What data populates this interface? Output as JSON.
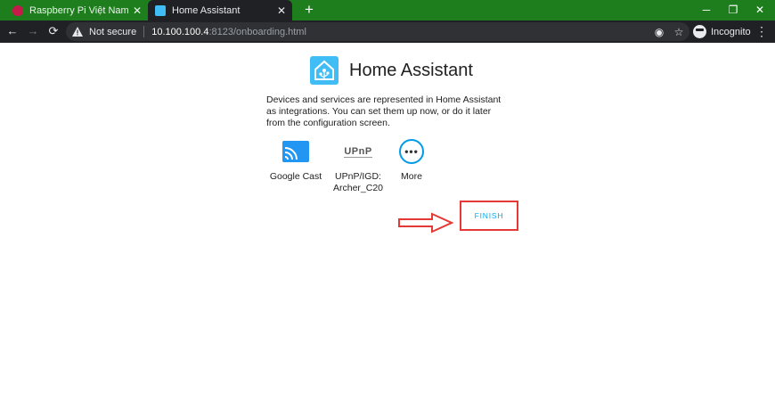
{
  "browser": {
    "tabs": [
      {
        "title": "Raspberry Pi Việt Nam - Nhà Phâ",
        "favicon": "raspberry-pi-icon",
        "active": false
      },
      {
        "title": "Home Assistant",
        "favicon": "home-assistant-icon",
        "active": true
      }
    ],
    "new_tab": "+",
    "security_label": "Not secure",
    "url_host": "10.100.100.4",
    "url_rest": ":8123/onboarding.html",
    "profile_label": "Incognito",
    "colors": {
      "tabstrip": "#1e7e1e",
      "toolbar": "#202124"
    }
  },
  "page": {
    "brand_title": "Home Assistant",
    "intro": "Devices and services are represented in Home Assistant as integrations. You can set them up now, or do it later from the configuration screen.",
    "integrations": [
      {
        "name": "Google Cast",
        "icon": "cast-icon"
      },
      {
        "name": "UPnP/IGD: Archer_C20",
        "icon": "upnp-icon",
        "logo_text": "UPnP"
      },
      {
        "name": "More",
        "icon": "more-icon"
      }
    ],
    "finish_label": "FINISH",
    "colors": {
      "accent": "#03a9f4",
      "highlight": "#e53935",
      "brand": "#41bdf5"
    }
  }
}
